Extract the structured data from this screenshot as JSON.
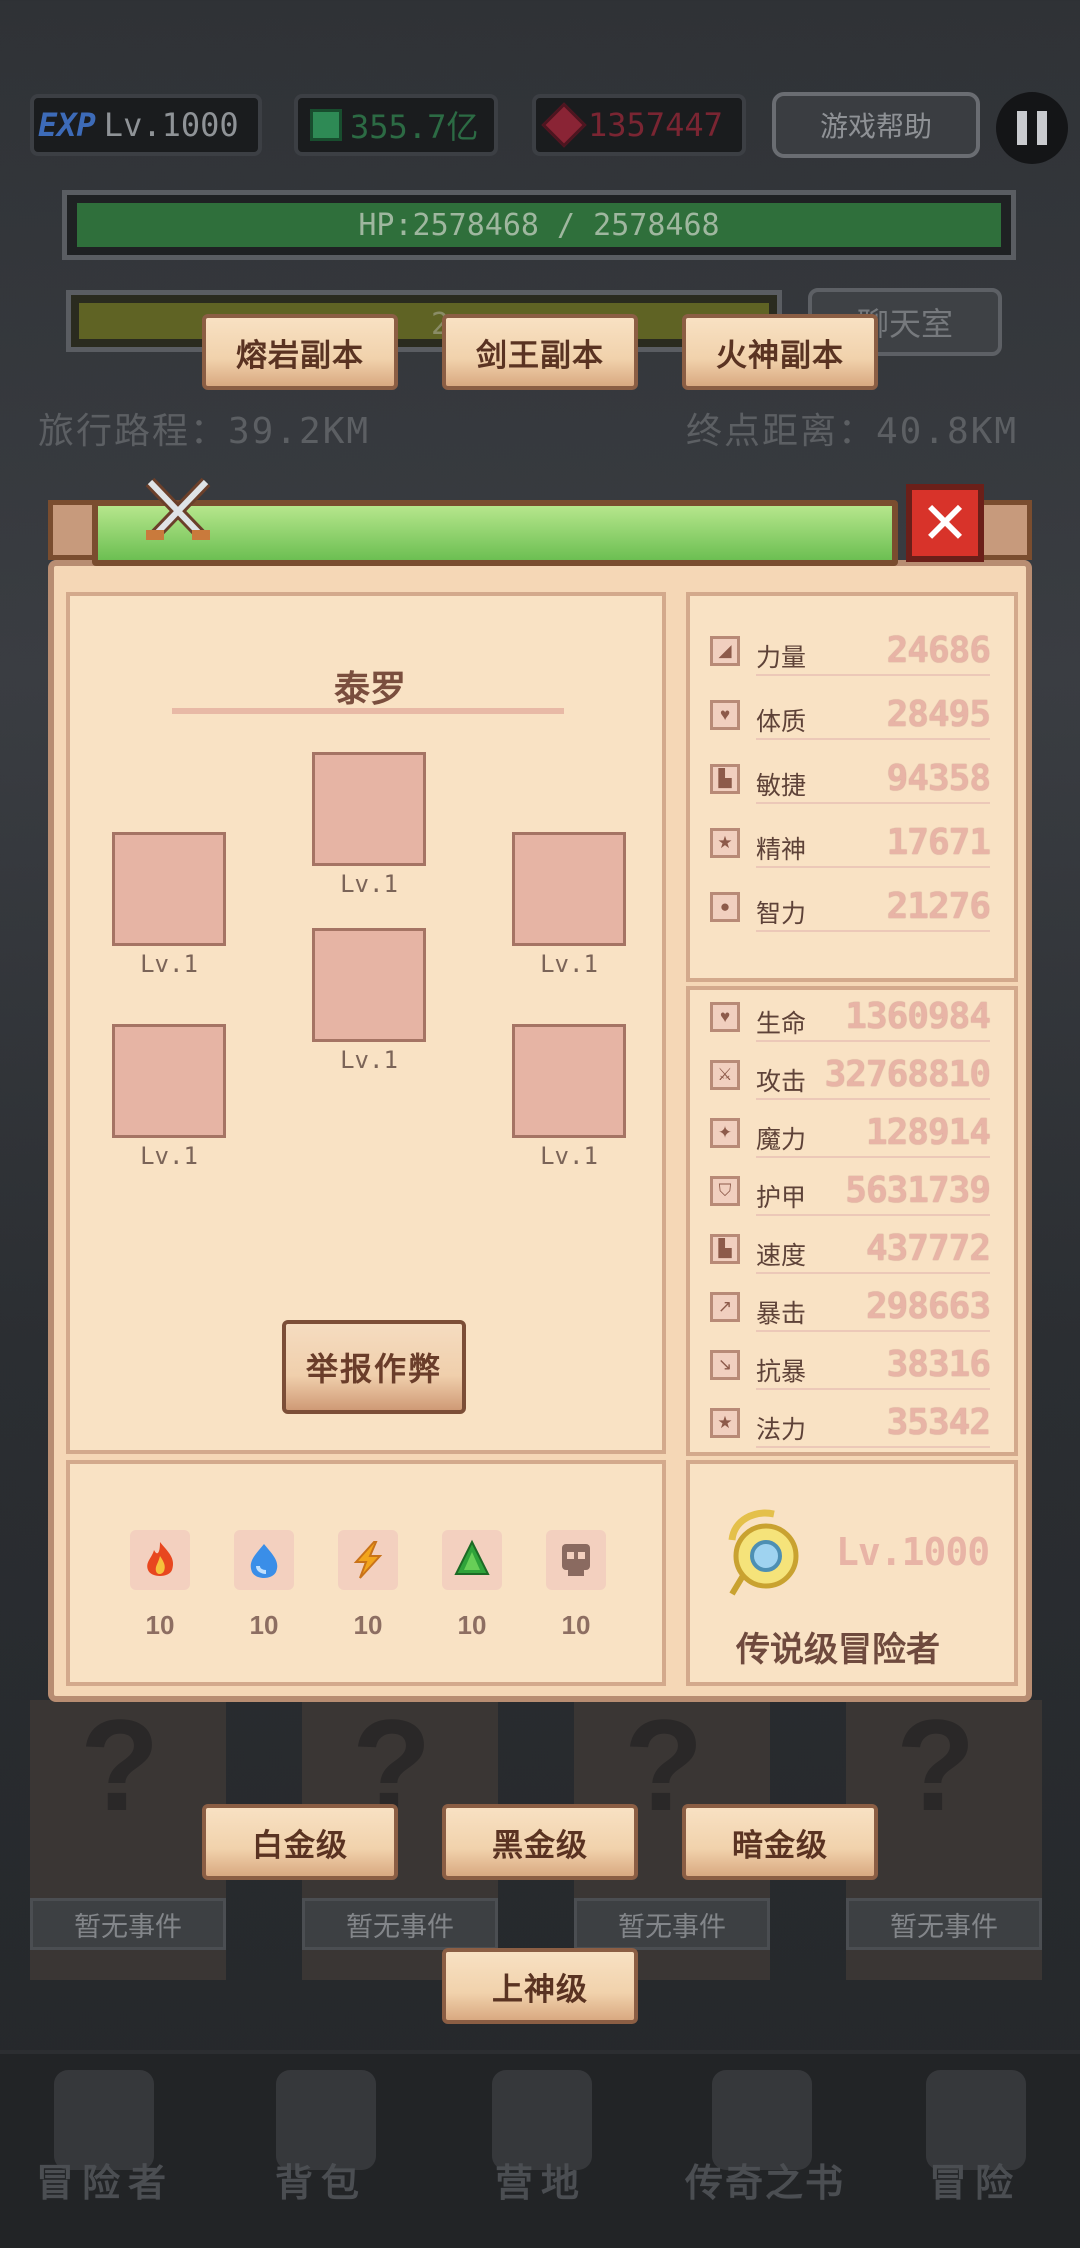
{
  "hud": {
    "exp_badge": "EXP",
    "level": "Lv.1000",
    "gems": "355.7亿",
    "rubies": "1357447",
    "help_label": "游戏帮助",
    "hp_text": "HP:2578468 / 2578468",
    "secondary_bar_text": "2",
    "chat_room_label": "聊天室",
    "travel_distance": "旅行路程：39.2KM",
    "destination_distance": "终点距离：40.8KM"
  },
  "dungeons": [
    "熔岩副本",
    "剑王副本",
    "火神副本"
  ],
  "character": {
    "name": "泰罗",
    "equip_levels": [
      "Lv.1",
      "Lv.1",
      "Lv.1",
      "Lv.1",
      "Lv.1",
      "Lv.1"
    ],
    "report_label": "举报作弊",
    "elements": [
      {
        "icon": "fire-icon",
        "value": "10",
        "color": "#e8471f"
      },
      {
        "icon": "water-icon",
        "value": "10",
        "color": "#3a8ee8"
      },
      {
        "icon": "lightning-icon",
        "value": "10",
        "color": "#f2a51c"
      },
      {
        "icon": "leaf-icon",
        "value": "10",
        "color": "#2fa33a"
      },
      {
        "icon": "skull-icon",
        "value": "10",
        "color": "#8a6a60"
      }
    ],
    "base_stats": [
      {
        "label": "力量",
        "value": "24686",
        "icon": "strength-icon"
      },
      {
        "label": "体质",
        "value": "28495",
        "icon": "heart-icon"
      },
      {
        "label": "敏捷",
        "value": "94358",
        "icon": "boot-icon"
      },
      {
        "label": "精神",
        "value": "17671",
        "icon": "star-icon"
      },
      {
        "label": "智力",
        "value": "21276",
        "icon": "brain-icon"
      }
    ],
    "combat_stats": [
      {
        "label": "生命",
        "value": "1360984",
        "icon": "heart-icon"
      },
      {
        "label": "攻击",
        "value": "32768810",
        "icon": "sword-icon"
      },
      {
        "label": "魔力",
        "value": "128914",
        "icon": "wand-icon"
      },
      {
        "label": "护甲",
        "value": "5631739",
        "icon": "shield-icon"
      },
      {
        "label": "速度",
        "value": "437772",
        "icon": "boot-icon"
      },
      {
        "label": "暴击",
        "value": "298663",
        "icon": "crit-icon"
      },
      {
        "label": "抗暴",
        "value": "38316",
        "icon": "crit-resist-icon"
      },
      {
        "label": "法力",
        "value": "35342",
        "icon": "star-icon"
      }
    ],
    "rank_level": "Lv.1000",
    "rank_title": "传说级冒险者"
  },
  "tiers": [
    "白金级",
    "黑金级",
    "暗金级",
    "上神级"
  ],
  "events": [
    "暂无事件",
    "暂无事件",
    "暂无事件",
    "暂无事件"
  ],
  "nav": [
    "冒险者",
    "背包",
    "营地",
    "传奇之书",
    "冒险"
  ],
  "colors": {
    "panel_bg": "#f5d7b6",
    "stat_value": "#e8b4a6",
    "title_bar": "#6cbf52",
    "close_button": "#d8332a"
  }
}
